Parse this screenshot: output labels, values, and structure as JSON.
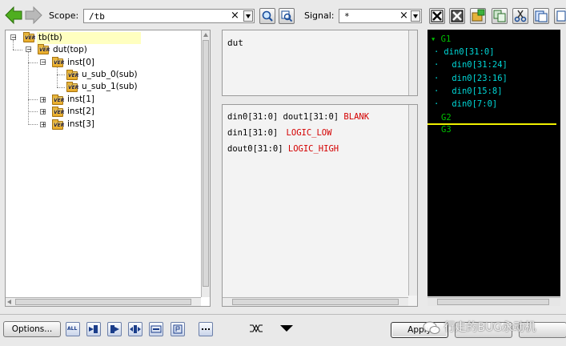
{
  "toolbar": {
    "scope_label": "Scope:",
    "scope_value": "/tb",
    "signal_label": "Signal:",
    "signal_value": "*",
    "clear_glyph": "×"
  },
  "tree": {
    "nodes": [
      {
        "label": "tb(tb)",
        "badge": "VER",
        "expanded": true,
        "selected": true
      },
      {
        "label": "dut(top)",
        "badge": "VER",
        "expanded": true
      },
      {
        "label": "inst[0]",
        "badge": "VER",
        "expanded": true
      },
      {
        "label": "u_sub_0(sub)",
        "badge": "VER"
      },
      {
        "label": "u_sub_1(sub)",
        "badge": "VER"
      },
      {
        "label": "inst[1]",
        "badge": "VER",
        "expanded": false
      },
      {
        "label": "inst[2]",
        "badge": "VER",
        "expanded": false
      },
      {
        "label": "inst[3]",
        "badge": "VER",
        "expanded": false
      }
    ]
  },
  "scope_panel": {
    "text": "dut"
  },
  "signal_panel": {
    "rows": [
      {
        "sig1": "din0[31:0]",
        "sig2": "dout1[31:0]",
        "tag": "BLANK"
      },
      {
        "sig1": "din1[31:0]",
        "tag": "LOGIC_LOW"
      },
      {
        "sig1": "dout0[31:0]",
        "tag": "LOGIC_HIGH"
      }
    ]
  },
  "waveform": {
    "groups": [
      "G1",
      "din0[31:0]",
      "din0[31:24]",
      "din0[23:16]",
      "din0[15:8]",
      "din0[7:0]",
      "G2",
      "G3"
    ],
    "background": "#000000",
    "signal_color": "#00d7d7",
    "marker_color": "#f0f000"
  },
  "bottom": {
    "options_label": "Options...",
    "all_badge": "ALL",
    "apply_label": "Apply",
    "watermark": "行走的BUG永动机"
  },
  "colors": {
    "tag_red": "#d40000",
    "selection": "#ffffc0"
  }
}
